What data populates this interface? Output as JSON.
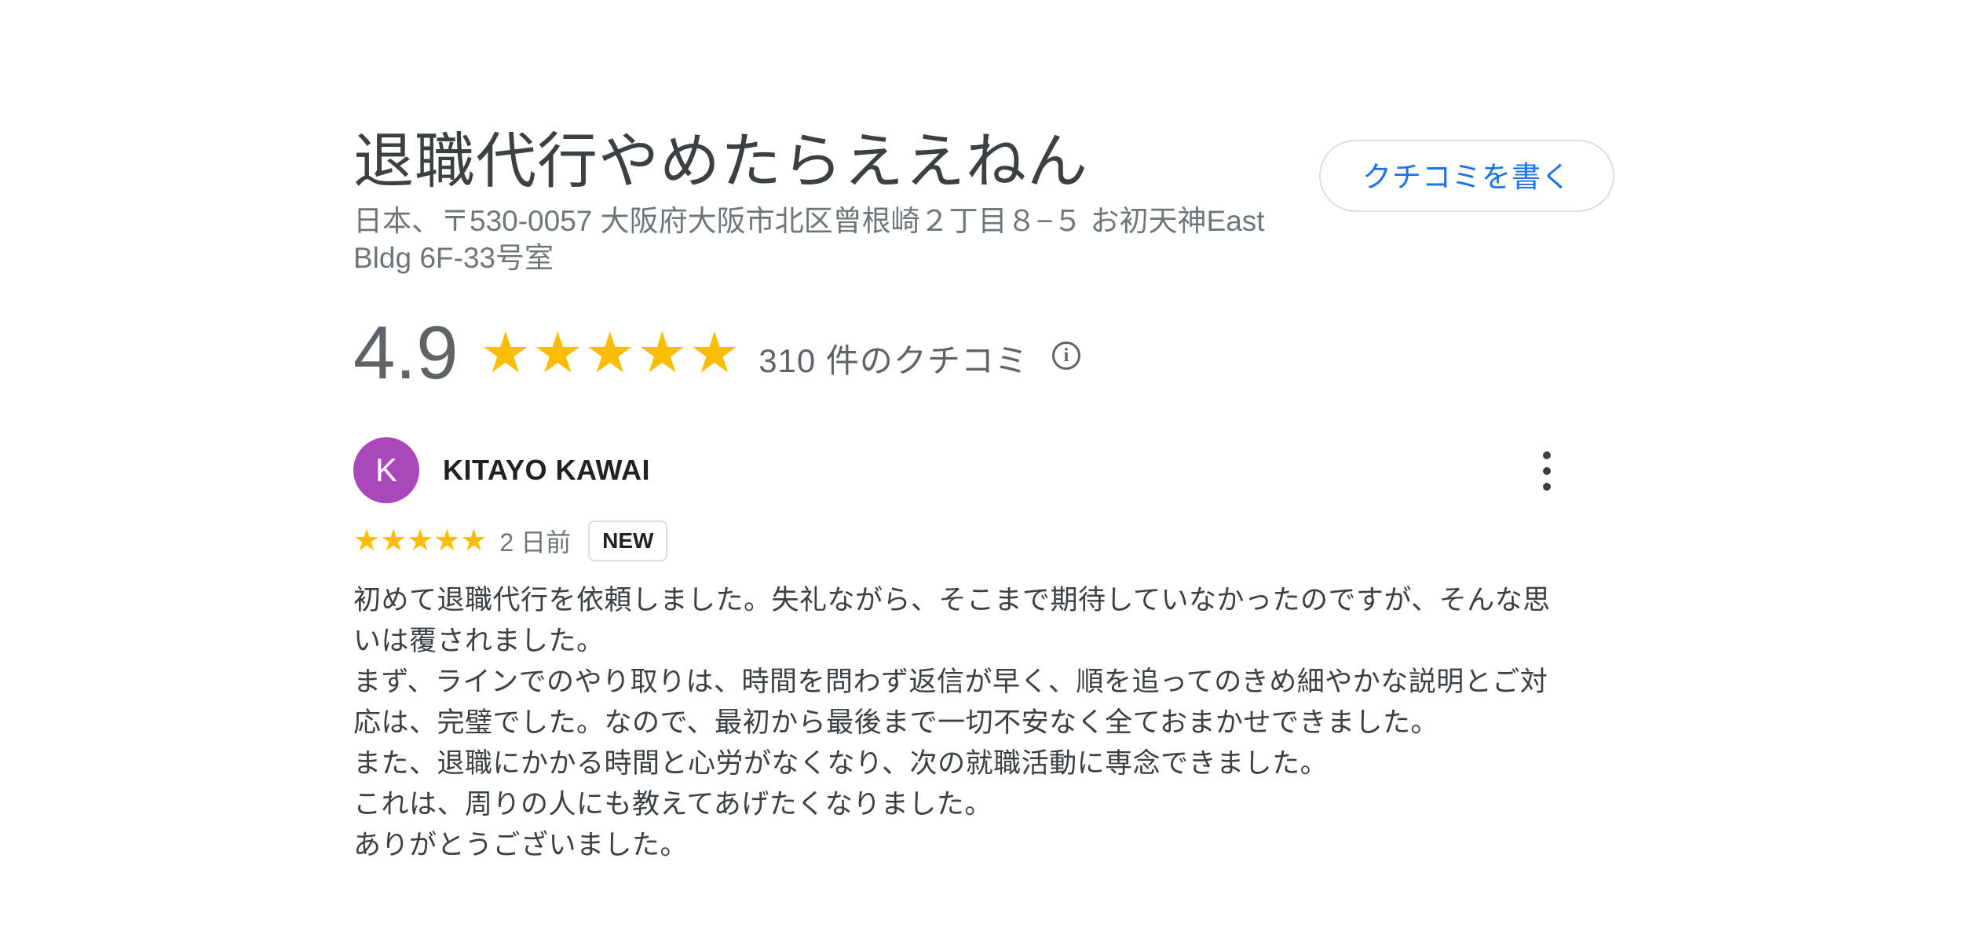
{
  "business": {
    "name": "退職代行やめたらええねん",
    "address": "日本、〒530-0057 大阪府大阪市北区曾根崎２丁目８−５ お初天神East Bldg 6F-33号室",
    "write_review_label": "クチコミを書く"
  },
  "rating": {
    "value": "4.9",
    "stars": 5,
    "review_count_text": "310 件のクチコミ",
    "star_glyph": "★",
    "star_color": "#fbbc04"
  },
  "review": {
    "avatar_initial": "K",
    "avatar_color": "#ab47bc",
    "reviewer_name": "KITAYO KAWAI",
    "stars": 5,
    "time_ago": "2 日前",
    "badge": "NEW",
    "paragraphs": [
      "初めて退職代行を依頼しました。失礼ながら、そこまで期待していなかったのですが、そんな思いは覆されました。",
      "まず、ラインでのやり取りは、時間を問わず返信が早く、順を追ってのきめ細やかな説明とご対応は、完璧でした。なので、最初から最後まで一切不安なく全ておまかせできました。",
      "また、退職にかかる時間と心労がなくなり、次の就職活動に専念できました。",
      "これは、周りの人にも教えてあげたくなりました。",
      "ありがとうございました。"
    ]
  },
  "icons": {
    "info": "info-icon",
    "more": "more-vert-icon"
  }
}
